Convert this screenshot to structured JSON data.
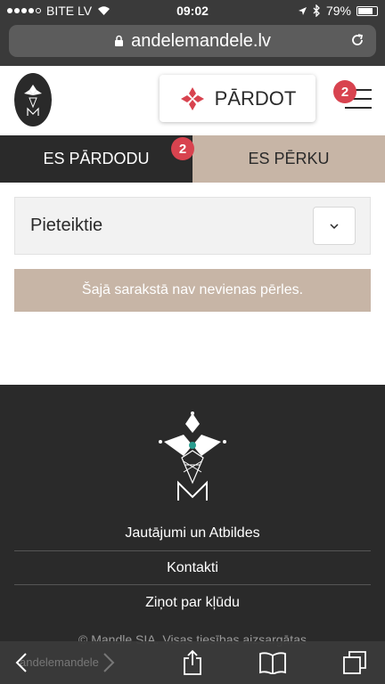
{
  "status_bar": {
    "carrier": "BITE LV",
    "time": "09:02",
    "battery_text": "79%",
    "battery_level": 0.79
  },
  "browser": {
    "url": "andelemandele.lv"
  },
  "header": {
    "sell_button_label": "PĀRDOT",
    "menu_badge": "2"
  },
  "tabs": {
    "sell_label": "ES PĀRDODU",
    "sell_badge": "2",
    "buy_label": "ES PĒRKU"
  },
  "filter": {
    "selected": "Pieteiktie"
  },
  "empty_message": "Šajā sarakstā nav nevienas pērles.",
  "footer": {
    "links": [
      "Jautājumi un Atbildes",
      "Kontakti",
      "Ziņot par kļūdu"
    ],
    "copyright": "© Mandle SIA. Visas tiesības aizsargātas"
  },
  "toolbar": {
    "logo_text": "andelemandele"
  },
  "colors": {
    "dark": "#2a2a2a",
    "beige": "#c7b5a6",
    "badge": "#d8434f",
    "accent_teal": "#2a9d8f"
  }
}
